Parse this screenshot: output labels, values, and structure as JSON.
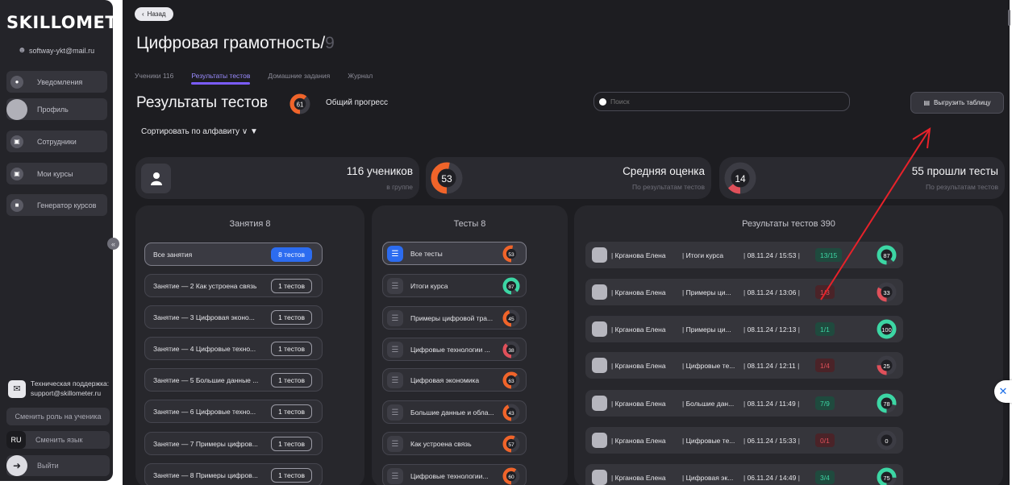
{
  "sidebar": {
    "logo": "SKILLOMETER",
    "email": "softway-ykt@mail.ru",
    "items": [
      {
        "label": "Уведомления"
      },
      {
        "label": "Профиль"
      },
      {
        "label": "Сотрудники"
      },
      {
        "label": "Мои курсы"
      },
      {
        "label": "Генератор курсов"
      }
    ],
    "support": "Техническая поддержка: support@skillometer.ru",
    "switch_role": "Сменить роль на ученика",
    "lang_code": "RU",
    "switch_lang": "Сменить язык",
    "logout": "Выйти"
  },
  "header": {
    "back": "Назад",
    "title": "Цифровая грамотность/",
    "title_suffix": "9",
    "tabs": [
      "Ученики 116",
      "Результаты тестов",
      "Домашние задания",
      "Журнал"
    ],
    "active_tab": 1
  },
  "section": {
    "title": "Результаты тестов",
    "overall_value": 61,
    "overall_label": "Общий прогресс",
    "search_placeholder": "Поиск",
    "export_label": "Выгрузить таблицу",
    "sort_label": "Сортировать по алфавиту"
  },
  "stats": {
    "students_value": "116 учеников",
    "students_sub": "в группе",
    "avg_ring": 53,
    "avg_value": "Средняя оценка",
    "avg_sub": "По результатам тестов",
    "passed_ring": 14,
    "passed_value": "55 прошли тесты",
    "passed_sub": "По результатам тестов"
  },
  "lessons": {
    "title": "Занятия 8",
    "items": [
      {
        "label": "Все занятия",
        "badge": "8 тестов"
      },
      {
        "label": "Занятие — 2 Как устроена связь",
        "badge": "1 тестов"
      },
      {
        "label": "Занятие — 3 Цифровая эконо...",
        "badge": "1 тестов"
      },
      {
        "label": "Занятие — 4 Цифровые техно...",
        "badge": "1 тестов"
      },
      {
        "label": "Занятие — 5 Большие данные ...",
        "badge": "1 тестов"
      },
      {
        "label": "Занятие — 6 Цифровые техно...",
        "badge": "1 тестов"
      },
      {
        "label": "Занятие — 7 Примеры цифров...",
        "badge": "1 тестов"
      },
      {
        "label": "Занятие — 8 Примеры цифров...",
        "badge": "1 тестов"
      }
    ]
  },
  "tests": {
    "title": "Тесты 8",
    "items": [
      {
        "label": "Все тесты",
        "value": 53
      },
      {
        "label": "Итоги курса",
        "value": 87
      },
      {
        "label": "Примеры цифровой тра...",
        "value": 45
      },
      {
        "label": "Цифровые технологии ...",
        "value": 38
      },
      {
        "label": "Цифровая экономика",
        "value": 63
      },
      {
        "label": "Большие данные и обла...",
        "value": 43
      },
      {
        "label": "Как устроена связь",
        "value": 57
      },
      {
        "label": "Цифровые технологии...",
        "value": 60
      }
    ]
  },
  "results": {
    "title": "Результаты тестов 390",
    "rows": [
      {
        "name": "Крганова Елена",
        "test": "Итоги курса",
        "date": "08.11.24 / 15:53",
        "score": "13/15",
        "status": "green",
        "value": 87
      },
      {
        "name": "Крганова Елена",
        "test": "Примеры ци...",
        "date": "08.11.24 / 13:06",
        "score": "1/3",
        "status": "red",
        "value": 33
      },
      {
        "name": "Крганова Елена",
        "test": "Примеры ци...",
        "date": "08.11.24 / 12:13",
        "score": "1/1",
        "status": "green",
        "value": 100
      },
      {
        "name": "Крганова Елена",
        "test": "Цифровые те...",
        "date": "08.11.24 / 12:11",
        "score": "1/4",
        "status": "red",
        "value": 25
      },
      {
        "name": "Крганова Елена",
        "test": "Большие дан...",
        "date": "08.11.24 / 11:49",
        "score": "7/9",
        "status": "green",
        "value": 78
      },
      {
        "name": "Крганова Елена",
        "test": "Цифровые те...",
        "date": "06.11.24 / 15:33",
        "score": "0/1",
        "status": "red",
        "value": 0
      },
      {
        "name": "Крганова Елена",
        "test": "Цифровая эк...",
        "date": "06.11.24 / 14:49",
        "score": "3/4",
        "status": "green",
        "value": 75
      }
    ]
  },
  "colors": {
    "accent": "#7b5cff",
    "primary": "#2c6cf0",
    "good": "#3cd6a4",
    "bad": "#e0505a",
    "arrow": "#e8222a"
  }
}
